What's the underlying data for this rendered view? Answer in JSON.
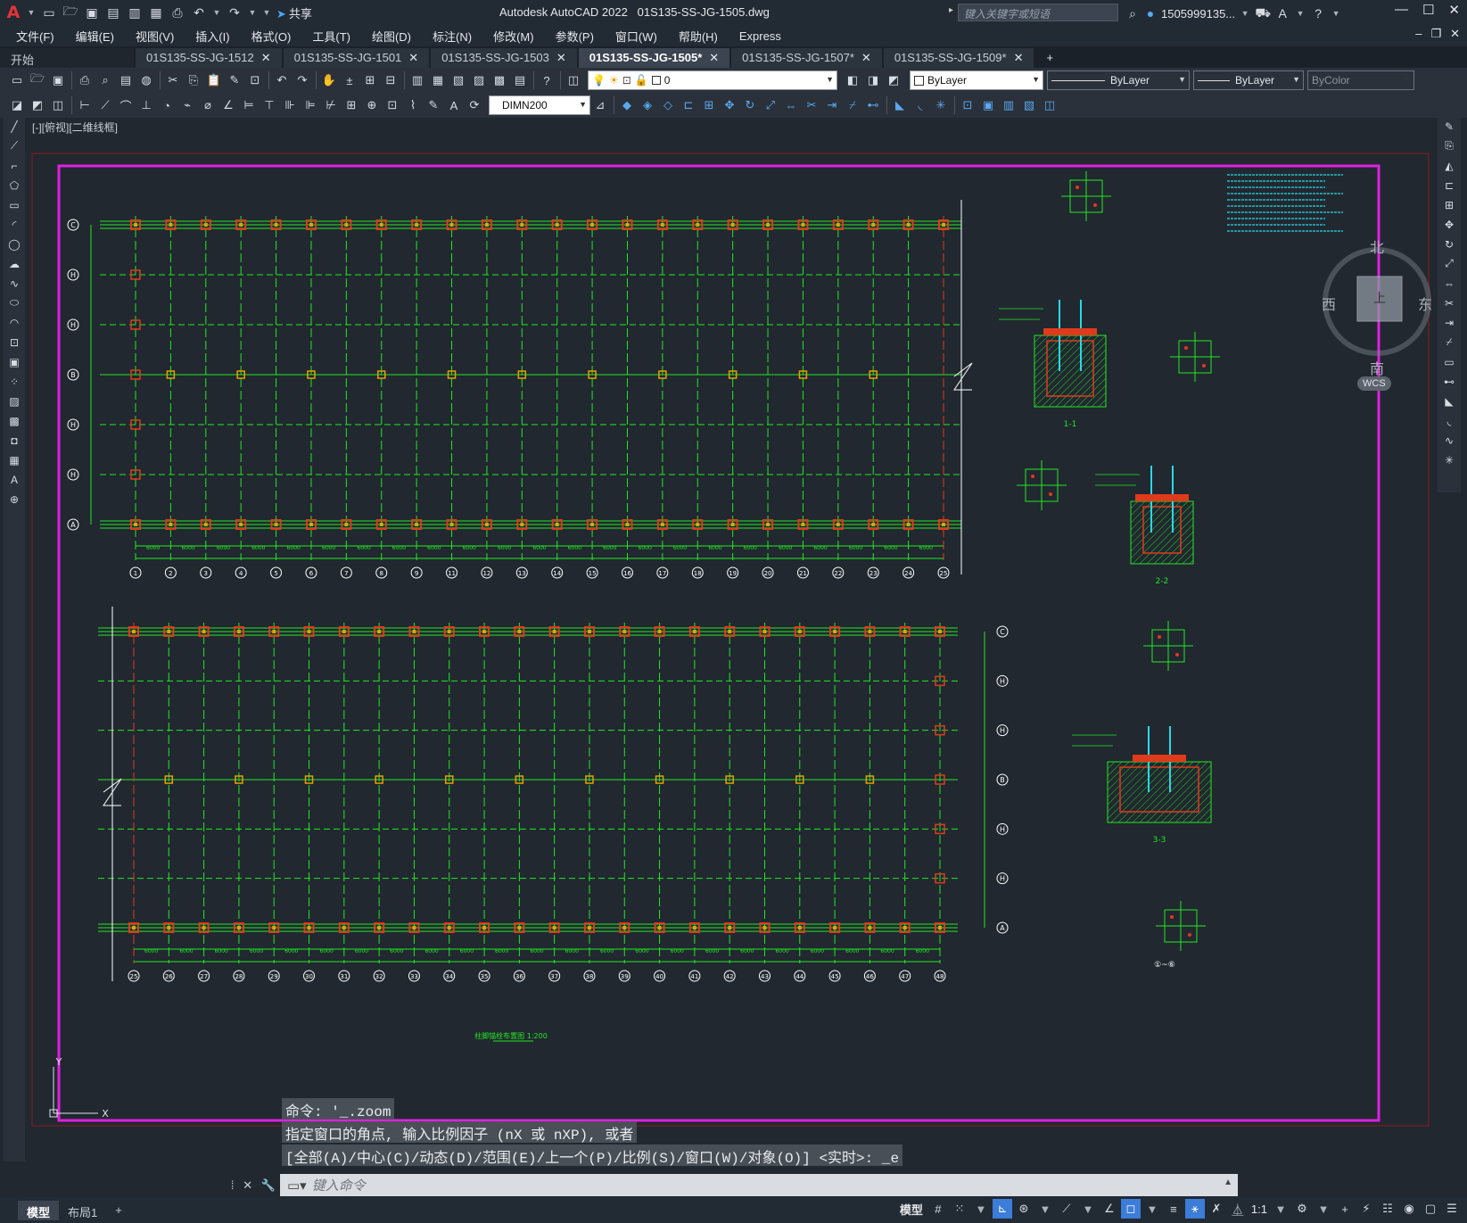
{
  "app": {
    "title": "Autodesk AutoCAD 2022",
    "file": "01S135-SS-JG-1505.dwg",
    "share_label": "共享",
    "search_placeholder": "键入关键字或短语",
    "user": "1505999135..."
  },
  "menu": [
    "文件(F)",
    "编辑(E)",
    "视图(V)",
    "插入(I)",
    "格式(O)",
    "工具(T)",
    "绘图(D)",
    "标注(N)",
    "修改(M)",
    "参数(P)",
    "窗口(W)",
    "帮助(H)",
    "Express"
  ],
  "tabs": [
    {
      "label": "开始"
    },
    {
      "label": "01S135-SS-JG-1512"
    },
    {
      "label": "01S135-SS-JG-1501"
    },
    {
      "label": "01S135-SS-JG-1503"
    },
    {
      "label": "01S135-SS-JG-1505*",
      "active": true
    },
    {
      "label": "01S135-SS-JG-1507*"
    },
    {
      "label": "01S135-SS-JG-1509*"
    }
  ],
  "toolbar": {
    "layer": "0",
    "color": "ByLayer",
    "linetype": "ByLayer",
    "lineweight": "ByLayer",
    "plotstyle": "ByColor",
    "dimstyle": "DIMN200"
  },
  "viewport": {
    "label": "[-][俯视][二维线框]",
    "compass": {
      "north": "北",
      "south": "南",
      "east": "东",
      "west": "西",
      "top": "上",
      "wcs": "WCS"
    }
  },
  "drawing": {
    "plan1": {
      "rows": [
        "C",
        "H",
        "H",
        "B",
        "H",
        "H",
        "A"
      ],
      "cols": [
        "1",
        "2",
        "3",
        "4",
        "5",
        "6",
        "7",
        "8",
        "9",
        "11",
        "12",
        "13",
        "14",
        "15",
        "16",
        "17",
        "18",
        "19",
        "20",
        "21",
        "22",
        "23",
        "24",
        "25"
      ]
    },
    "plan2": {
      "rows": [
        "C",
        "H",
        "H",
        "B",
        "H",
        "H",
        "A"
      ],
      "cols": [
        "25",
        "26",
        "27",
        "28",
        "29",
        "30",
        "31",
        "32",
        "33",
        "34",
        "35",
        "36",
        "37",
        "38",
        "39",
        "40",
        "41",
        "42",
        "43",
        "44",
        "45",
        "46",
        "47",
        "48"
      ]
    },
    "plan_title": "柱脚锚栓布置图 1:200",
    "detail_labels": [
      "1-1",
      "2-2",
      "3-3",
      "①~⑥"
    ]
  },
  "command": {
    "history": [
      "命令: '_.zoom",
      "指定窗口的角点, 输入比例因子 (nX 或 nXP), 或者",
      "[全部(A)/中心(C)/动态(D)/范围(E)/上一个(P)/比例(S)/窗口(W)/对象(O)] <实时>: _e"
    ],
    "placeholder": "键入命令"
  },
  "status": {
    "tabs": [
      "模型",
      "布局1"
    ],
    "model_label": "模型",
    "scale": "1:1"
  },
  "colors": {
    "bg": "#212830",
    "magenta": "#e020e0",
    "green": "#22e822",
    "red": "#e03a1c",
    "orange": "#e6a000",
    "cyan": "#2ad8e8"
  }
}
